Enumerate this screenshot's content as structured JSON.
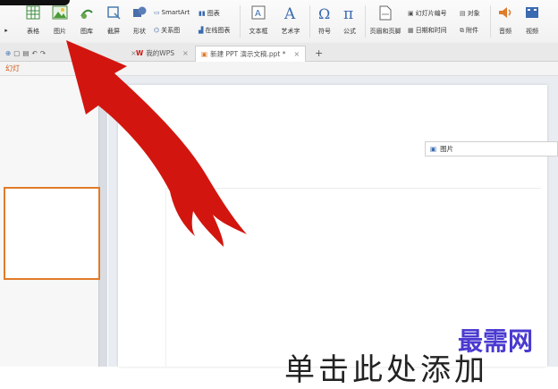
{
  "ribbon": {
    "row1_small": {
      "smartart": "SmartArt",
      "chart": "图表",
      "slide_number": "幻灯片编号",
      "object": "对象"
    },
    "row2_small": {
      "relation_chart": "关系图",
      "online_chart": "在线图表",
      "date_time": "日期和时间",
      "attachment": "附件"
    },
    "buttons": {
      "partial_left": "▸",
      "table": "表格",
      "picture": "图片",
      "gallery": "图库",
      "screenshot": "截屏",
      "shapes": "形状",
      "textbox": "文本框",
      "wordart": "艺术字",
      "symbol": "符号",
      "formula": "公式",
      "header_footer": "页眉和页脚",
      "audio": "音频",
      "video": "视频"
    }
  },
  "tabs": {
    "mywps": "我的WPS",
    "doc": "新建 PPT 演示文稿.ppt *",
    "add": "+"
  },
  "strip": {
    "first_label": "幻灯"
  },
  "slide": {
    "picture_box": "图片",
    "placeholder_text": "单击此处添加",
    "watermark": "最需网"
  },
  "colors": {
    "arrow": "#d2160f",
    "accent": "#e07b2a",
    "watermark": "#4a3ad0"
  }
}
